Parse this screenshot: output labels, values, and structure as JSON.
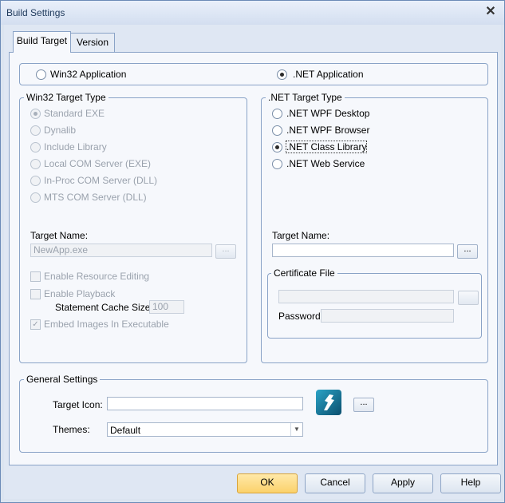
{
  "window": {
    "title": "Build Settings"
  },
  "tabs": [
    {
      "label": "Build Target"
    },
    {
      "label": "Version"
    }
  ],
  "app_type": {
    "win32_label": "Win32 Application",
    "net_label": ".NET Application",
    "selected": ".NET Application"
  },
  "win32": {
    "legend": "Win32 Target Type",
    "options": [
      {
        "label": "Standard EXE"
      },
      {
        "label": "Dynalib"
      },
      {
        "label": "Include Library"
      },
      {
        "label": "Local COM Server (EXE)"
      },
      {
        "label": "In-Proc COM Server (DLL)"
      },
      {
        "label": "MTS COM Server (DLL)"
      }
    ],
    "selected": "Standard EXE",
    "target_name_label": "Target Name:",
    "target_name_value": "NewApp.exe",
    "browse_label": "...",
    "resource_editing_label": "Enable Resource Editing",
    "playback_label": "Enable Playback",
    "cache_label": "Statement Cache Size:",
    "cache_value": "100",
    "embed_label": "Embed Images In Executable",
    "embed_checked": true
  },
  "net": {
    "legend": ".NET Target Type",
    "options": [
      {
        "label": ".NET WPF Desktop"
      },
      {
        "label": ".NET WPF Browser"
      },
      {
        "label": ".NET Class Library"
      },
      {
        "label": ".NET Web Service"
      }
    ],
    "selected": ".NET Class Library",
    "target_name_label": "Target Name:",
    "target_name_value": "",
    "browse_label": "...",
    "cert_legend": "Certificate File",
    "cert_value": "",
    "password_label": "Password:",
    "password_value": ""
  },
  "general": {
    "legend": "General Settings",
    "icon_label": "Target Icon:",
    "icon_value": "",
    "icon_browse": "...",
    "themes_label": "Themes:",
    "themes_value": "Default"
  },
  "buttons": {
    "ok": "OK",
    "cancel": "Cancel",
    "apply": "Apply",
    "help": "Help"
  },
  "icons": {
    "close": "close-icon",
    "app_icon": "app-icon",
    "dropdown": "chevron-down-icon"
  }
}
